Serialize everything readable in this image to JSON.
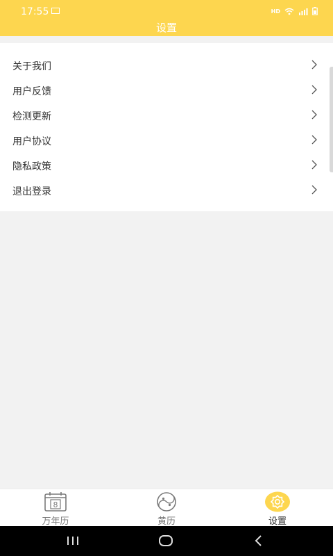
{
  "status_bar": {
    "time": "17:55",
    "hd": "HD"
  },
  "header": {
    "title": "设置"
  },
  "menu": {
    "items": [
      {
        "label": "关于我们"
      },
      {
        "label": "用户反馈"
      },
      {
        "label": "检测更新"
      },
      {
        "label": "用户协议"
      },
      {
        "label": "隐私政策"
      },
      {
        "label": "退出登录"
      }
    ]
  },
  "tabbar": {
    "tabs": [
      {
        "label": "万年历",
        "icon": "calendar-icon",
        "calendar_day": "8",
        "active": false
      },
      {
        "label": "黄历",
        "icon": "yin-yang-icon",
        "active": false
      },
      {
        "label": "设置",
        "icon": "gear-icon",
        "active": true
      }
    ]
  },
  "colors": {
    "accent": "#fdd64f",
    "background": "#f2f2f2",
    "text": "#333333"
  }
}
